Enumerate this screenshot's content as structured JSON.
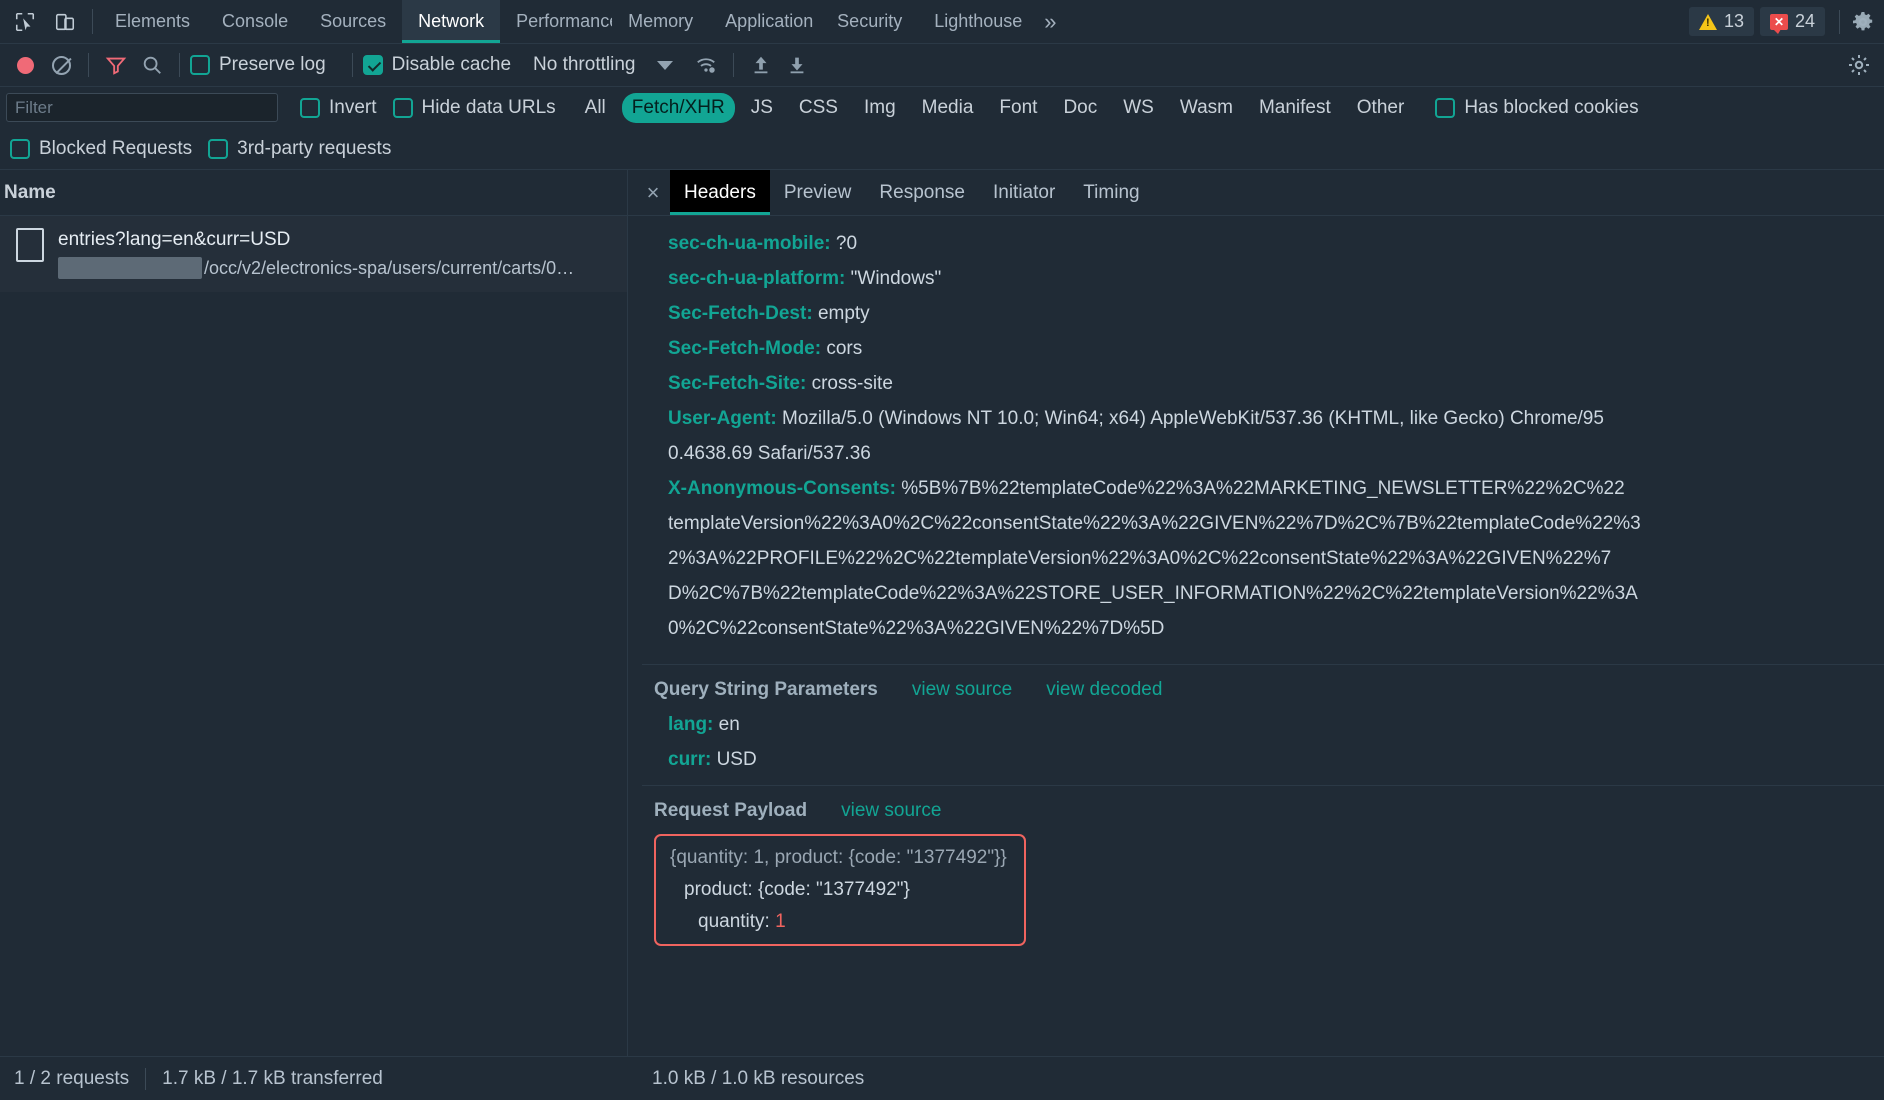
{
  "tabbar": {
    "icons": [
      {
        "name": "inspect-element-icon"
      },
      {
        "name": "device-toolbar-icon"
      }
    ],
    "tabs": [
      {
        "label": "Elements",
        "active": false
      },
      {
        "label": "Console",
        "active": false
      },
      {
        "label": "Sources",
        "active": false
      },
      {
        "label": "Network",
        "active": true
      },
      {
        "label": "Performance",
        "active": false
      },
      {
        "label": "Memory",
        "active": false
      },
      {
        "label": "Application",
        "active": false
      },
      {
        "label": "Security",
        "active": false
      },
      {
        "label": "Lighthouse",
        "active": false
      }
    ],
    "more_label": "»",
    "warnings_count": "13",
    "errors_count": "24",
    "settings_icon": "gear-icon",
    "accent_color": "#12a594"
  },
  "toolbar": {
    "record_title": "record-button",
    "clear_title": "clear-button",
    "filter_icon": "filter-icon",
    "search_icon": "search-icon",
    "preserve_log_label": "Preserve log",
    "preserve_log_checked": false,
    "disable_cache_label": "Disable cache",
    "disable_cache_checked": true,
    "throttling_label": "No throttling",
    "wifi_icon": "wifi-settings-icon",
    "import_icon": "import-har-icon",
    "export_icon": "export-har-icon",
    "settings_icon": "network-settings-gear-icon"
  },
  "filter": {
    "placeholder": "Filter",
    "value": "",
    "invert_label": "Invert",
    "invert_checked": false,
    "hide_data_urls_label": "Hide data URLs",
    "hide_data_urls_checked": false,
    "types": [
      {
        "label": "All",
        "active": false
      },
      {
        "label": "Fetch/XHR",
        "active": true
      },
      {
        "label": "JS",
        "active": false
      },
      {
        "label": "CSS",
        "active": false
      },
      {
        "label": "Img",
        "active": false
      },
      {
        "label": "Media",
        "active": false
      },
      {
        "label": "Font",
        "active": false
      },
      {
        "label": "Doc",
        "active": false
      },
      {
        "label": "WS",
        "active": false
      },
      {
        "label": "Wasm",
        "active": false
      },
      {
        "label": "Manifest",
        "active": false
      },
      {
        "label": "Other",
        "active": false
      }
    ],
    "has_blocked_cookies_label": "Has blocked cookies",
    "has_blocked_cookies_checked": false,
    "blocked_requests_label": "Blocked Requests",
    "blocked_requests_checked": false,
    "third_party_label": "3rd-party requests",
    "third_party_checked": false
  },
  "request_list": {
    "column_header": "Name",
    "rows": [
      {
        "name": "entries?lang=en&curr=USD",
        "path_suffix": "/occ/v2/electronics-spa/users/current/carts/0…",
        "redacted": true,
        "selected": true
      }
    ]
  },
  "detail": {
    "close_label": "×",
    "tabs": [
      {
        "label": "Headers",
        "active": true
      },
      {
        "label": "Preview",
        "active": false
      },
      {
        "label": "Response",
        "active": false
      },
      {
        "label": "Initiator",
        "active": false
      },
      {
        "label": "Timing",
        "active": false
      }
    ],
    "headers": [
      {
        "name": "sec-ch-ua-mobile:",
        "value": "?0"
      },
      {
        "name": "sec-ch-ua-platform:",
        "value": "\"Windows\""
      },
      {
        "name": "Sec-Fetch-Dest:",
        "value": "empty"
      },
      {
        "name": "Sec-Fetch-Mode:",
        "value": "cors"
      },
      {
        "name": "Sec-Fetch-Site:",
        "value": "cross-site"
      },
      {
        "name": "User-Agent:",
        "value": "Mozilla/5.0 (Windows NT 10.0; Win64; x64) AppleWebKit/537.36 (KHTML, like Gecko) Chrome/95"
      }
    ],
    "user_agent_wrap": "0.4638.69 Safari/537.36",
    "anon_consents": {
      "name": "X-Anonymous-Consents:",
      "lines": [
        "%5B%7B%22templateCode%22%3A%22MARKETING_NEWSLETTER%22%2C%22",
        "templateVersion%22%3A0%2C%22consentState%22%3A%22GIVEN%22%7D%2C%7B%22templateCode%22%3",
        "2%3A%22PROFILE%22%2C%22templateVersion%22%3A0%2C%22consentState%22%3A%22GIVEN%22%7",
        "D%2C%7B%22templateCode%22%3A%22STORE_USER_INFORMATION%22%2C%22templateVersion%22%3A",
        "0%2C%22consentState%22%3A%22GIVEN%22%7D%5D"
      ]
    },
    "query_string": {
      "title": "Query String Parameters",
      "view_source_label": "view source",
      "view_decoded_label": "view decoded",
      "params": [
        {
          "name": "lang:",
          "value": "en"
        },
        {
          "name": "curr:",
          "value": "USD"
        }
      ]
    },
    "request_payload": {
      "title": "Request Payload",
      "view_source_label": "view source",
      "highlight_color": "#f0645f",
      "summary": "{quantity: 1, product: {code: \"1377492\"}}",
      "rows": [
        {
          "key": "product",
          "sep": ":",
          "value": "{code: \"1377492\"}",
          "kind": "object"
        },
        {
          "key": "quantity",
          "sep": ":",
          "value": "1",
          "kind": "number"
        }
      ]
    }
  },
  "statusbar": {
    "requests": "1 / 2 requests",
    "transferred": "1.7 kB / 1.7 kB transferred",
    "resources": "1.0 kB / 1.0 kB resources"
  }
}
